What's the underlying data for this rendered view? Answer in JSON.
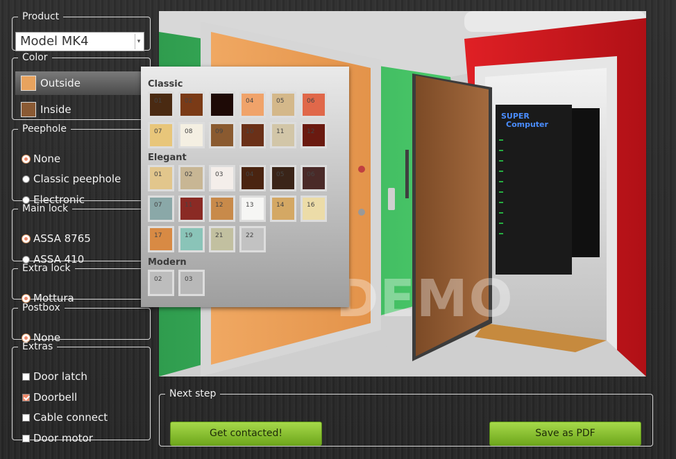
{
  "product": {
    "legend": "Product",
    "selected": "Model MK4"
  },
  "color": {
    "legend": "Color",
    "options": [
      {
        "label": "Outside",
        "swatch": "#e8a35e",
        "active": true
      },
      {
        "label": "Inside",
        "swatch": "#8a5a34",
        "active": false
      }
    ]
  },
  "peephole": {
    "legend": "Peephole",
    "options": [
      "None",
      "Classic peephole",
      "Electronic"
    ],
    "selected": "None"
  },
  "main_lock": {
    "legend": "Main lock",
    "options": [
      "ASSA 8765",
      "ASSA 410"
    ],
    "selected": "ASSA 8765"
  },
  "extra_lock": {
    "legend": "Extra lock",
    "options": [
      "Mottura"
    ],
    "selected": "Mottura"
  },
  "postbox": {
    "legend": "Postbox",
    "options": [
      "None"
    ],
    "selected": "None"
  },
  "extras": {
    "legend": "Extras",
    "options": [
      {
        "label": "Door latch",
        "checked": false
      },
      {
        "label": "Doorbell",
        "checked": true
      },
      {
        "label": "Cable connect",
        "checked": false
      },
      {
        "label": "Door motor",
        "checked": false
      }
    ]
  },
  "picker": {
    "categories": [
      {
        "name": "Classic",
        "swatches": [
          {
            "code": "01",
            "color": "#4a2a12"
          },
          {
            "code": "02",
            "color": "#7a3a16"
          },
          {
            "code": "",
            "color": "#1e0a06"
          },
          {
            "code": "04",
            "color": "#f0a36a"
          },
          {
            "code": "05",
            "color": "#d4b88a"
          },
          {
            "code": "06",
            "color": "#e0684a"
          },
          {
            "code": "07",
            "color": "#e8c67a"
          },
          {
            "code": "08",
            "color": "#f4efe2"
          },
          {
            "code": "09",
            "color": "#8a5a30"
          },
          {
            "code": "10",
            "color": "#6a3018"
          },
          {
            "code": "11",
            "color": "#d2c6a8"
          },
          {
            "code": "12",
            "color": "#6a1a10"
          }
        ]
      },
      {
        "name": "Elegant",
        "swatches": [
          {
            "code": "01",
            "color": "#e2c68c"
          },
          {
            "code": "02",
            "color": "#c8b694"
          },
          {
            "code": "03",
            "color": "#f4eeea"
          },
          {
            "code": "04",
            "color": "#4a2410"
          },
          {
            "code": "05",
            "color": "#3a2418"
          },
          {
            "code": "06",
            "color": "#4a2a28"
          },
          {
            "code": "07",
            "color": "#8aa8a8"
          },
          {
            "code": "11",
            "color": "#8a2a24"
          },
          {
            "code": "12",
            "color": "#c88a4a"
          },
          {
            "code": "13",
            "color": "#f6f6f4"
          },
          {
            "code": "14",
            "color": "#d4a864"
          },
          {
            "code": "16",
            "color": "#ecdca8"
          },
          {
            "code": "17",
            "color": "#d88a44"
          },
          {
            "code": "19",
            "color": "#8ac4b8"
          },
          {
            "code": "21",
            "color": "#c2c0a0"
          },
          {
            "code": "22",
            "color": "#c2c2c2"
          }
        ]
      },
      {
        "name": "Modern",
        "swatches": [
          {
            "code": "02",
            "color": "#bdbdbd"
          },
          {
            "code": "03",
            "color": "#b8b8b8"
          }
        ]
      }
    ]
  },
  "scene": {
    "watermark": "DEMO",
    "rack_label_1": "SUPER",
    "rack_label_2": "Computer"
  },
  "next_step": {
    "legend": "Next step",
    "contact_label": "Get contacted!",
    "pdf_label": "Save as PDF"
  },
  "colors": {
    "accent_green": "#8cc63f",
    "radio_on": "#f08a6a",
    "wall_green": "#43c266",
    "wall_red": "#d8191f"
  }
}
